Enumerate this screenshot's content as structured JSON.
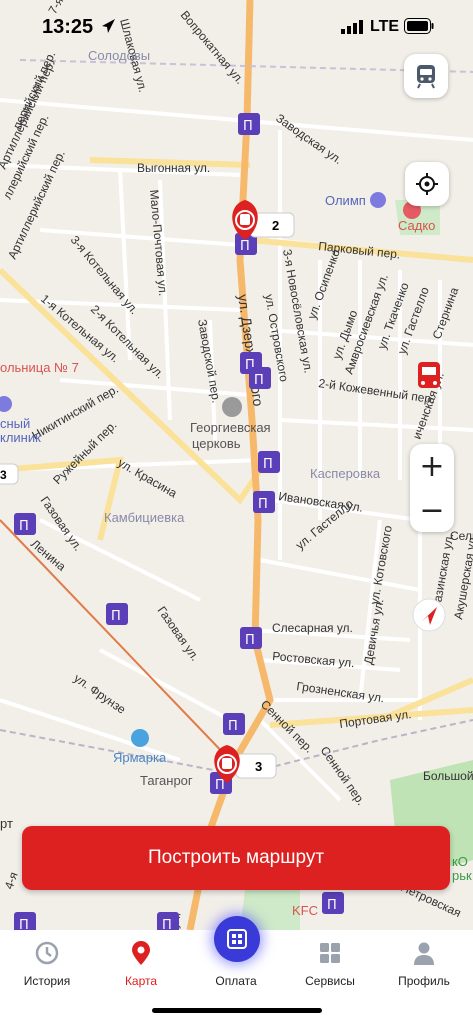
{
  "status_bar": {
    "time": "13:25",
    "network": "LTE"
  },
  "map": {
    "streets": [
      "Шлаковая ул.",
      "Вопрокатная ул.",
      "Заводская ул.",
      "Выгонная ул.",
      "Мало-Почтовая ул.",
      "3-я Котельная ул.",
      "2-я Котельная ул.",
      "1-я Котельная ул.",
      "Парковый пер.",
      "3-я Новосёловская ул.",
      "ул. Осипенко",
      "Амвросиевская ул.",
      "ул. Ткаченко",
      "ул. Гастелло",
      "Стернина",
      "ул. Дымо",
      "ул. Островского",
      "ул. Дзержинского",
      "2-й Кожевенный пер.",
      "Заводской пер.",
      "Никитинский пер.",
      "Ружейный пер.",
      "ул. Красина",
      "Газовая ул.",
      "Ивановская ул.",
      "ул. Гастелло",
      "ул. Котовского",
      "Разинская ул.",
      "Акушерская ул.",
      "Девичья ул.",
      "Слесарная ул.",
      "Ростовская ул.",
      "Газовая ул.",
      "ул. Фрунзе",
      "Грозненская ул.",
      "Сенной пер.",
      "Портовая ул.",
      "Сенной пер.",
      "Большой",
      "Ленина",
      "Сель",
      "иченская ул.",
      "Петровская",
      "ллерийский пер.",
      "Артиллерийский пер.",
      "Артиллерийский пер.",
      "7-я",
      "перийский пер.",
      "ая ул.",
      "4-я"
    ],
    "places": {
      "soldovo": "Солодовы",
      "olimp": "Олимп",
      "sadko": "Садко",
      "hospital": "ольница № 7",
      "clinic": "сный\nклиник",
      "church": "Георгиевская\nцерковь",
      "kasperovka": "Касперовка",
      "kambitsievka": "Камбициевка",
      "yarmarka": "Ярмарка",
      "taganrog": "Таганрог",
      "kfc": "KFC",
      "park": "кО\nрьк"
    },
    "markers": [
      {
        "label": "2"
      },
      {
        "label": "3"
      }
    ],
    "edge_label": "3",
    "bottom_label": "рт"
  },
  "controls": {
    "transport_icon": "tram-icon",
    "locate_icon": "crosshair-icon",
    "zoom_in": "+",
    "zoom_out": "−"
  },
  "route_button": {
    "label": "Построить маршрут"
  },
  "tabbar": {
    "items": [
      {
        "label": "История",
        "icon": "history-icon"
      },
      {
        "label": "Карта",
        "icon": "map-pin-icon"
      },
      {
        "label": "Оплата",
        "icon": "qr-pay-icon"
      },
      {
        "label": "Сервисы",
        "icon": "grid-icon"
      },
      {
        "label": "Профиль",
        "icon": "person-icon"
      }
    ],
    "active": "Карта"
  },
  "colors": {
    "accent": "#dd2020",
    "stop_purple": "#5a3fb8",
    "main_road": "#f6b96b",
    "pay_blue": "#3a3ad8"
  }
}
